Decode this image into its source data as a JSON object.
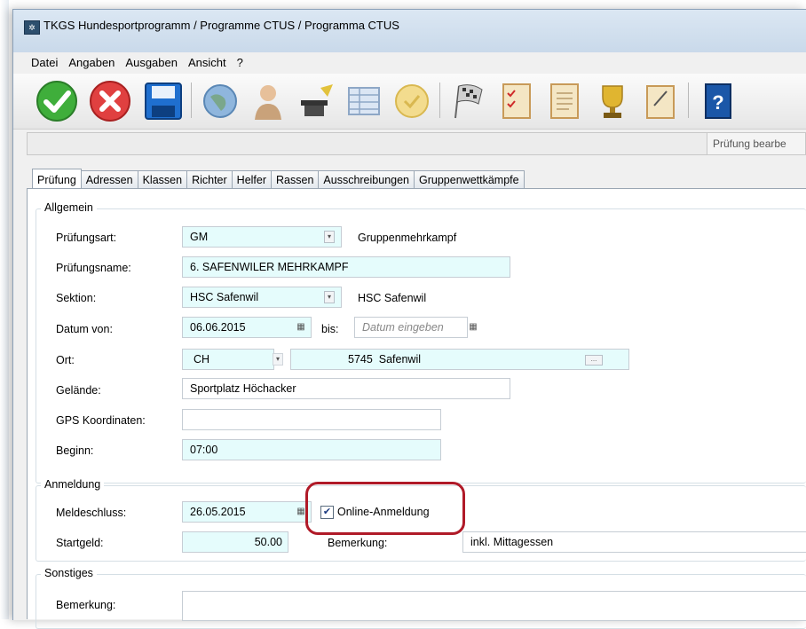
{
  "window": {
    "title": "TKGS Hundesportprogramm / Programme CTUS / Programma CTUS"
  },
  "menu": [
    "Datei",
    "Angaben",
    "Ausgaben",
    "Ansicht",
    "?"
  ],
  "toolbar_buttons": [
    "ok-icon",
    "cancel-icon",
    "save-icon",
    "globe-icon",
    "person-icon",
    "wizard-icon",
    "table-icon",
    "badge-icon",
    "flag-icon",
    "checklist-icon",
    "document-icon",
    "trophy-icon",
    "clipboard-icon",
    "help-book-icon"
  ],
  "status": {
    "right_text": "Prüfung bearbe"
  },
  "tabs": [
    "Prüfung",
    "Adressen",
    "Klassen",
    "Richter",
    "Helfer",
    "Rassen",
    "Ausschreibungen",
    "Gruppenwettkämpfe"
  ],
  "allgemein": {
    "title": "Allgemein",
    "pruefungsart_label": "Prüfungsart:",
    "pruefungsart_value": "GM",
    "pruefungsart_desc": "Gruppenmehrkampf",
    "name_label": "Prüfungsname:",
    "name_value": "6. SAFENWILER MEHRKAMPF",
    "sektion_label": "Sektion:",
    "sektion_value": "HSC Safenwil",
    "sektion_desc": "HSC Safenwil",
    "datum_label": "Datum von:",
    "datum_value": "06.06.2015",
    "bis_label": "bis:",
    "bis_placeholder": "Datum eingeben",
    "ort_label": "Ort:",
    "ort_country": "CH",
    "ort_plz": "5745",
    "ort_name": "Safenwil",
    "ort_more": "...",
    "gelaende_label": "Gelände:",
    "gelaende_value": "Sportplatz Höchacker",
    "gps_label": "GPS Koordinaten:",
    "gps_value": "",
    "beginn_label": "Beginn:",
    "beginn_value": "07:00"
  },
  "anmeldung": {
    "title": "Anmeldung",
    "meldeschluss_label": "Meldeschluss:",
    "meldeschluss_value": "26.05.2015",
    "online_label": "Online-Anmeldung",
    "online_checked": true,
    "startgeld_label": "Startgeld:",
    "startgeld_value": "50.00",
    "bemerkung_label": "Bemerkung:",
    "bemerkung_value": "inkl. Mittagessen"
  },
  "sonstiges": {
    "title": "Sonstiges",
    "bemerkung_label": "Bemerkung:",
    "bemerkung_value": ""
  },
  "colors": {
    "field_bg": "#e5fcfc",
    "highlight": "#b01a28"
  }
}
